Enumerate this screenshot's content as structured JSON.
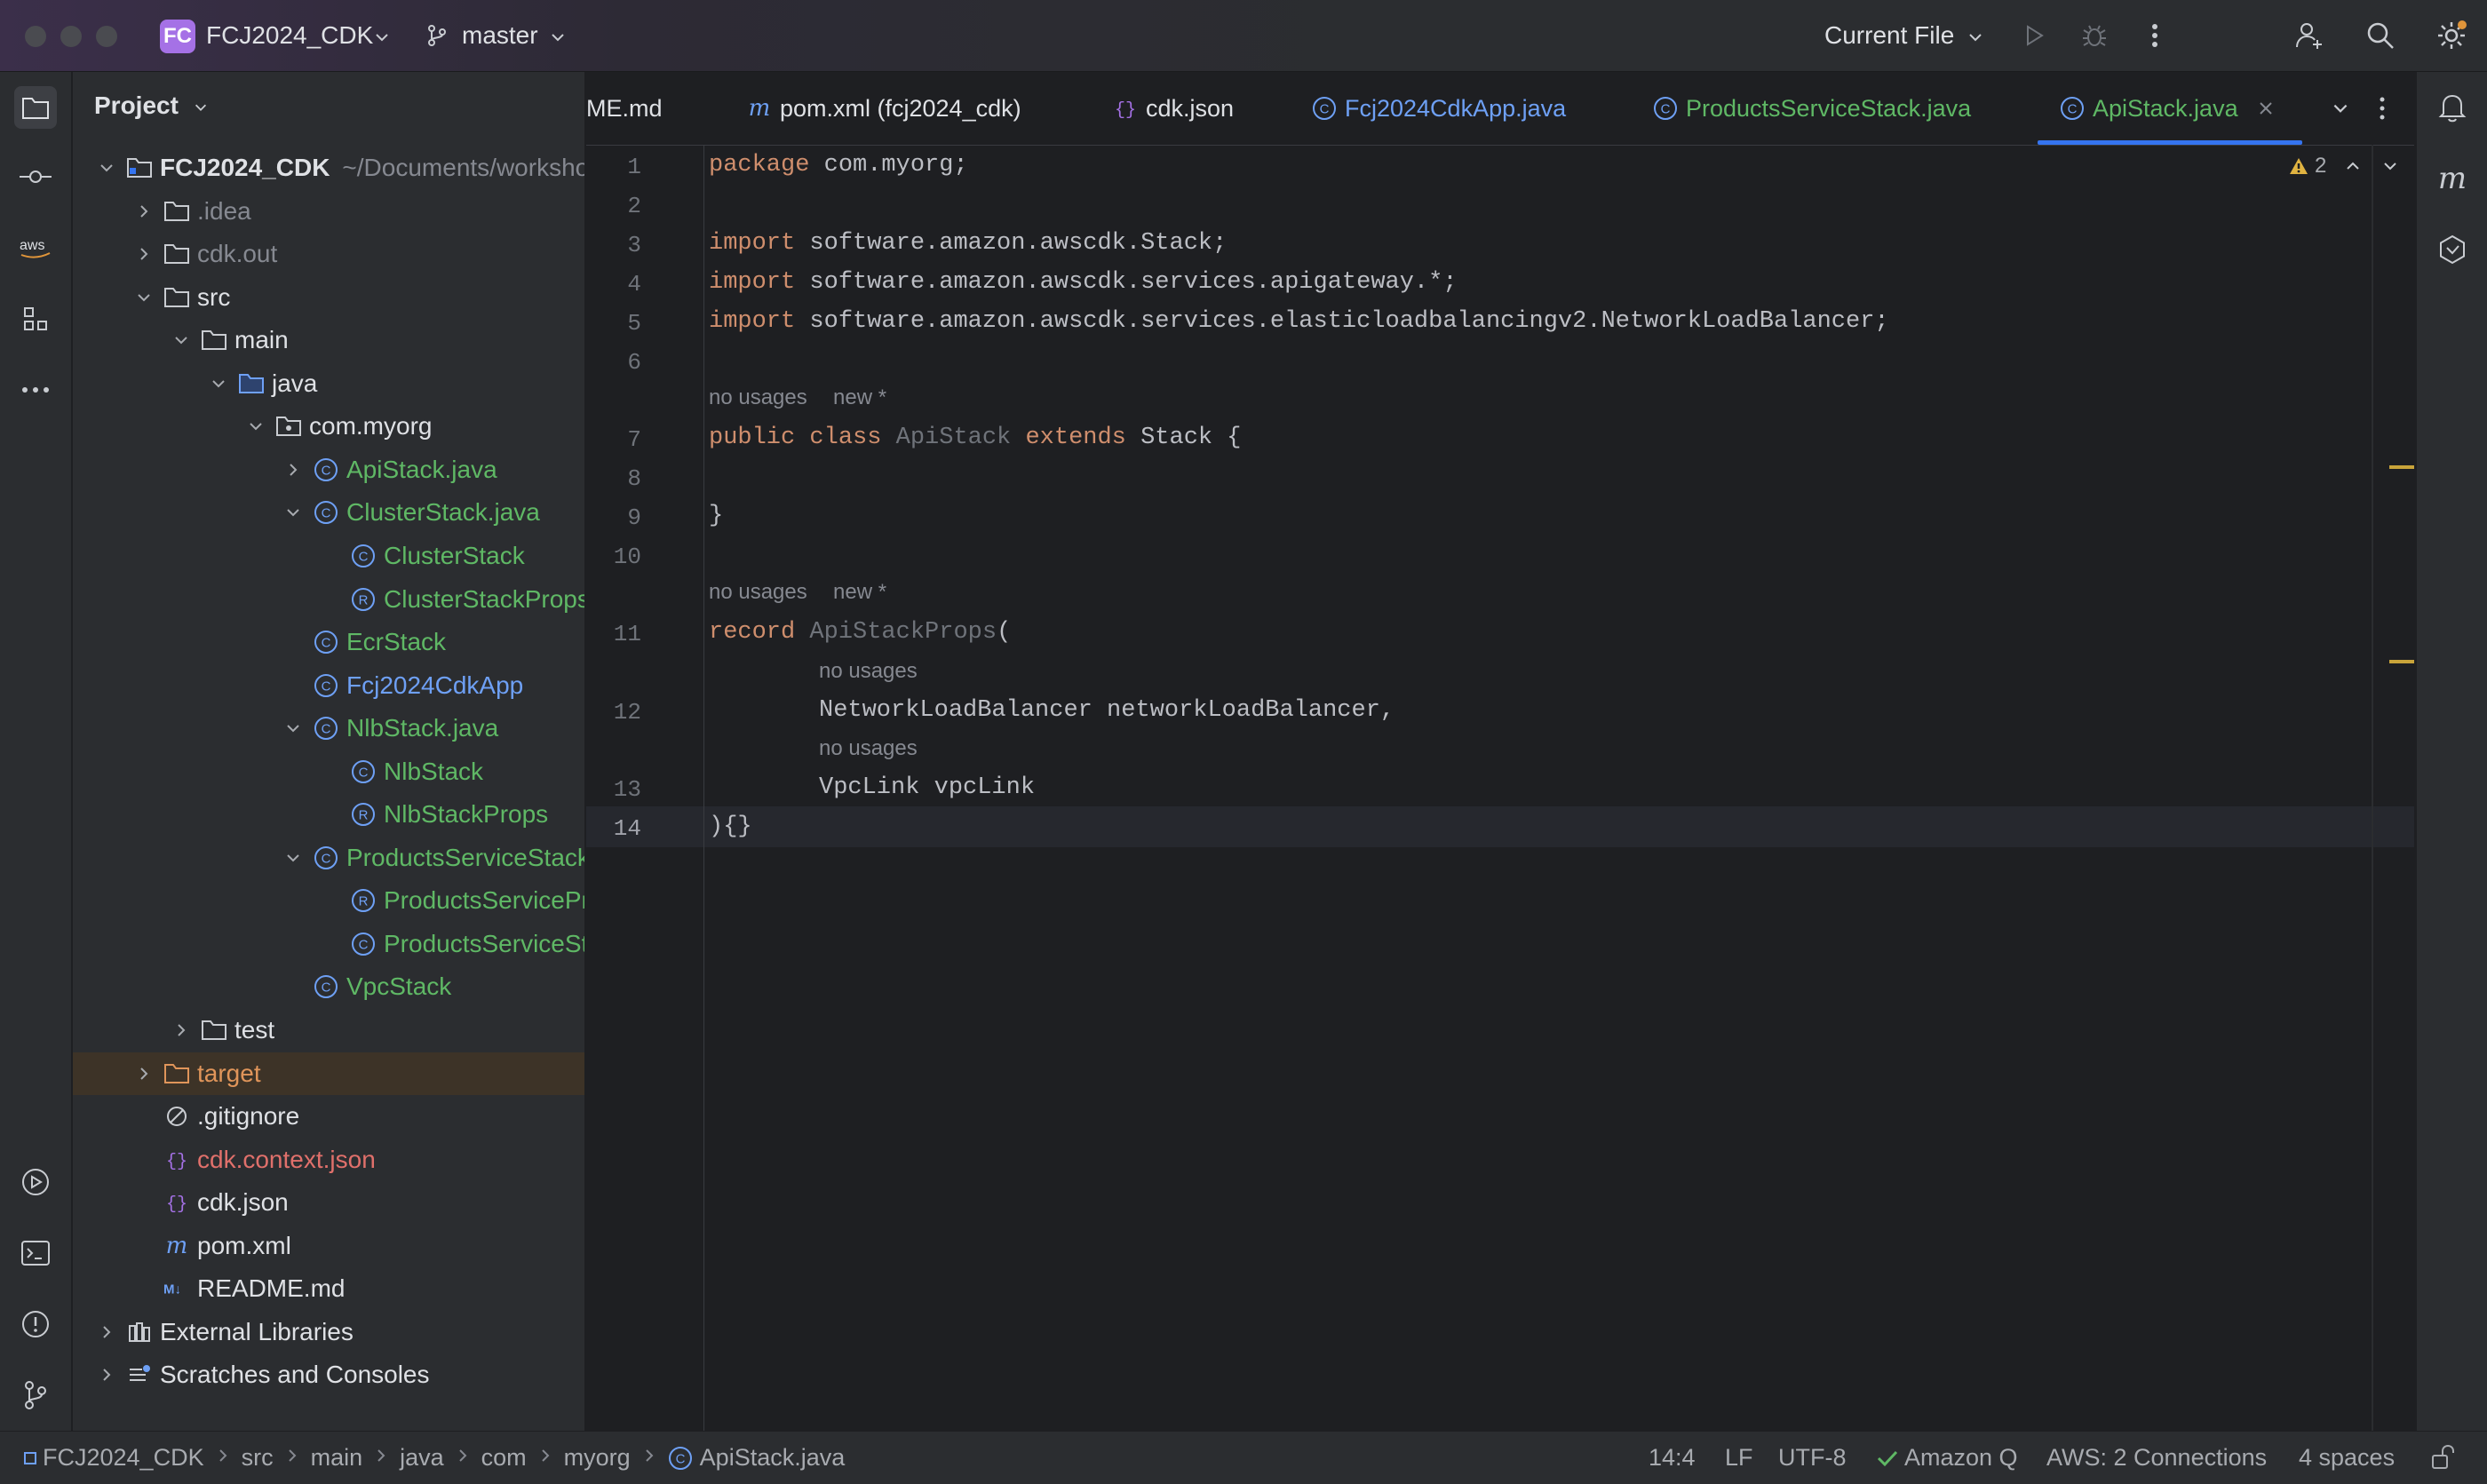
{
  "window": {
    "project_badge": "FC",
    "project_name": "FCJ2024_CDK",
    "branch": "master",
    "run_config": "Current File"
  },
  "project_panel": {
    "title": "Project",
    "tree": [
      {
        "label": "FCJ2024_CDK",
        "suffix": "~/Documents/workshop",
        "level": 0,
        "chevron": "down",
        "icon": "module-folder",
        "color": "#dfe1e5",
        "bold": true
      },
      {
        "label": ".idea",
        "level": 1,
        "chevron": "right",
        "icon": "folder",
        "color": "#868991"
      },
      {
        "label": "cdk.out",
        "level": 1,
        "chevron": "right",
        "icon": "folder",
        "color": "#868991"
      },
      {
        "label": "src",
        "level": 1,
        "chevron": "down",
        "icon": "folder",
        "color": "#dfe1e5"
      },
      {
        "label": "main",
        "level": 2,
        "chevron": "down",
        "icon": "folder",
        "color": "#dfe1e5"
      },
      {
        "label": "java",
        "level": 3,
        "chevron": "down",
        "icon": "source-folder",
        "color": "#dfe1e5"
      },
      {
        "label": "com.myorg",
        "level": 4,
        "chevron": "down",
        "icon": "package",
        "color": "#dfe1e5"
      },
      {
        "label": "ApiStack.java",
        "level": 5,
        "chevron": "right",
        "icon": "class",
        "color": "#5fb865"
      },
      {
        "label": "ClusterStack.java",
        "level": 5,
        "chevron": "down",
        "icon": "class",
        "color": "#5fb865"
      },
      {
        "label": "ClusterStack",
        "level": 6,
        "chevron": "none",
        "icon": "class",
        "color": "#5fb865"
      },
      {
        "label": "ClusterStackProps",
        "level": 6,
        "chevron": "none",
        "icon": "record",
        "color": "#5fb865"
      },
      {
        "label": "EcrStack",
        "level": 5,
        "chevron": "none",
        "icon": "class",
        "color": "#5fb865"
      },
      {
        "label": "Fcj2024CdkApp",
        "level": 5,
        "chevron": "none",
        "icon": "class",
        "color": "#6ea0f5"
      },
      {
        "label": "NlbStack.java",
        "level": 5,
        "chevron": "down",
        "icon": "class",
        "color": "#5fb865"
      },
      {
        "label": "NlbStack",
        "level": 6,
        "chevron": "none",
        "icon": "class",
        "color": "#5fb865"
      },
      {
        "label": "NlbStackProps",
        "level": 6,
        "chevron": "none",
        "icon": "record",
        "color": "#5fb865"
      },
      {
        "label": "ProductsServiceStack.j",
        "level": 5,
        "chevron": "down",
        "icon": "class",
        "color": "#5fb865"
      },
      {
        "label": "ProductsServicePro",
        "level": 6,
        "chevron": "none",
        "icon": "record",
        "color": "#5fb865"
      },
      {
        "label": "ProductsServiceSta",
        "level": 6,
        "chevron": "none",
        "icon": "class",
        "color": "#5fb865"
      },
      {
        "label": "VpcStack",
        "level": 5,
        "chevron": "none",
        "icon": "class",
        "color": "#5fb865"
      },
      {
        "label": "test",
        "level": 2,
        "chevron": "right",
        "icon": "folder",
        "color": "#dfe1e5"
      },
      {
        "label": "target",
        "level": 1,
        "chevron": "right",
        "icon": "folder-orange",
        "color": "#e0955a",
        "selected": true
      },
      {
        "label": ".gitignore",
        "level": 1,
        "chevron": "none",
        "icon": "ignore",
        "color": "#dfe1e5"
      },
      {
        "label": "cdk.context.json",
        "level": 1,
        "chevron": "none",
        "icon": "json",
        "color": "#e0706b"
      },
      {
        "label": "cdk.json",
        "level": 1,
        "chevron": "none",
        "icon": "json",
        "color": "#dfe1e5"
      },
      {
        "label": "pom.xml",
        "level": 1,
        "chevron": "none",
        "icon": "maven",
        "color": "#dfe1e5"
      },
      {
        "label": "README.md",
        "level": 1,
        "chevron": "none",
        "icon": "markdown",
        "color": "#dfe1e5"
      },
      {
        "label": "External Libraries",
        "level": 0,
        "chevron": "right",
        "icon": "libraries",
        "color": "#dfe1e5"
      },
      {
        "label": "Scratches and Consoles",
        "level": 0,
        "chevron": "right",
        "icon": "scratches",
        "color": "#dfe1e5"
      }
    ]
  },
  "tabs": [
    {
      "label": "ME.md",
      "icon": "none",
      "color": "#dfe1e5"
    },
    {
      "label": "pom.xml (fcj2024_cdk)",
      "icon": "maven",
      "color": "#dfe1e5"
    },
    {
      "label": "cdk.json",
      "icon": "json",
      "color": "#dfe1e5"
    },
    {
      "label": "Fcj2024CdkApp.java",
      "icon": "class",
      "color": "#6ea0f5"
    },
    {
      "label": "ProductsServiceStack.java",
      "icon": "class",
      "color": "#5fb865"
    },
    {
      "label": "ApiStack.java",
      "icon": "class",
      "color": "#5fb865",
      "active": true
    }
  ],
  "editor": {
    "warning_count": "2",
    "line_numbers": [
      "1",
      "2",
      "3",
      "4",
      "5",
      "6",
      "7",
      "8",
      "9",
      "10",
      "11",
      "12",
      "13",
      "14"
    ],
    "hints": {
      "usages_a": "no usages",
      "new_a": "new *",
      "usages_b": "no usages",
      "new_b": "new *",
      "usages_c": "no usages",
      "usages_d": "no usages"
    },
    "code": {
      "l1_kw": "package",
      "l1_rest": " com.myorg;",
      "l3_kw": "import",
      "l3_rest": " software.amazon.awscdk.Stack;",
      "l4_kw": "import",
      "l4_rest": " software.amazon.awscdk.services.apigateway.*;",
      "l5_kw": "import",
      "l5_rest": " software.amazon.awscdk.services.elasticloadbalancingv2.NetworkLoadBalancer;",
      "l7_kw1": "public class",
      "l7_cls": " ApiStack",
      "l7_kw2": " extends",
      "l7_rest": " Stack {",
      "l9": "}",
      "l11_kw": "record",
      "l11_cls": " ApiStackProps",
      "l11_rest": "(",
      "l12": "NetworkLoadBalancer networkLoadBalancer,",
      "l13": "VpcLink vpcLink",
      "l14": "){}"
    }
  },
  "status_bar": {
    "breadcrumbs": [
      "FCJ2024_CDK",
      "src",
      "main",
      "java",
      "com",
      "myorg",
      "ApiStack.java"
    ],
    "position": "14:4",
    "line_sep": "LF",
    "encoding": "UTF-8",
    "amazon_q": "Amazon Q",
    "aws": "AWS: 2 Connections",
    "indent": "4 spaces"
  },
  "colors": {
    "accent": "#3574f0",
    "keyword": "#cf8e6d",
    "class_icon": "#5fb865",
    "badge": "#a571e6",
    "warning": "#e0b341"
  }
}
